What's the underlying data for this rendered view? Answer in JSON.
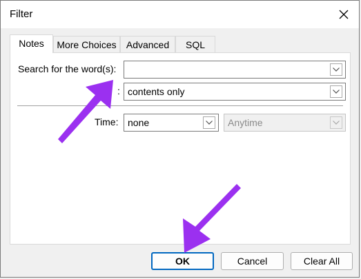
{
  "dialog": {
    "title": "Filter"
  },
  "tabs": [
    {
      "label": "Notes",
      "active": true
    },
    {
      "label": "More Choices",
      "active": false
    },
    {
      "label": "Advanced",
      "active": false
    },
    {
      "label": "SQL",
      "active": false
    }
  ],
  "search": {
    "label": "Search for the word(s):",
    "value": ""
  },
  "in_field": {
    "label_visible_fragment": ":",
    "value": "contents only"
  },
  "time": {
    "label": "Time:",
    "value": "none",
    "range_value": "Anytime"
  },
  "buttons": {
    "ok": "OK",
    "cancel": "Cancel",
    "clear_all": "Clear All"
  },
  "colors": {
    "accent": "#0067c0",
    "annotation_arrow": "#9b30f0"
  },
  "icons": {
    "close": "close-icon",
    "dropdown": "chevron-down-icon"
  }
}
